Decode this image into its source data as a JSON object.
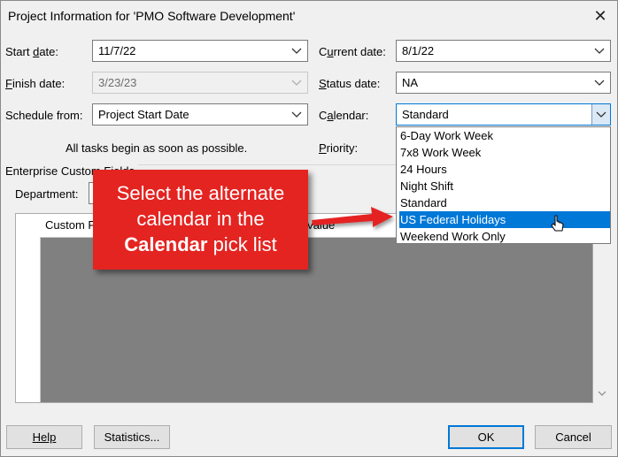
{
  "window": {
    "title": "Project Information for 'PMO Software Development'",
    "close_glyph": "✕"
  },
  "fields": {
    "start_date": {
      "label_pre": "Start ",
      "label_u": "d",
      "label_post": "ate:",
      "value": "11/7/22"
    },
    "finish_date": {
      "label_pre": "",
      "label_u": "F",
      "label_post": "inish date:",
      "value": "3/23/23"
    },
    "schedule_from": {
      "label": "Schedule from:",
      "value": "Project Start Date"
    },
    "schedule_note": "All tasks begin as soon as possible.",
    "current_date": {
      "label_pre": "C",
      "label_u": "u",
      "label_post": "rrent date:",
      "value": "8/1/22"
    },
    "status_date": {
      "label_pre": "",
      "label_u": "S",
      "label_post": "tatus date:",
      "value": "NA"
    },
    "calendar": {
      "label_pre": "C",
      "label_u": "a",
      "label_post": "lendar:",
      "value": "Standard"
    },
    "priority": {
      "label_pre": "",
      "label_u": "P",
      "label_post": "riority:"
    }
  },
  "calendar_options": [
    {
      "label": "6-Day Work Week",
      "selected": false
    },
    {
      "label": "7x8 Work Week",
      "selected": false
    },
    {
      "label": "24 Hours",
      "selected": false
    },
    {
      "label": "Night Shift",
      "selected": false
    },
    {
      "label": "Standard",
      "selected": false
    },
    {
      "label": "US Federal Holidays",
      "selected": true
    },
    {
      "label": "Weekend Work Only",
      "selected": false
    }
  ],
  "enterprise": {
    "section_label": "Enterprise Custom Fields",
    "department_label": "Department:",
    "grid_headers": [
      "Custom F",
      "Value"
    ]
  },
  "buttons": {
    "help": "Help",
    "statistics": "Statistics...",
    "ok": "OK",
    "cancel": "Cancel"
  },
  "callout": {
    "line1": "Select the alternate",
    "line2": "calendar in the",
    "line3_bold": "Calendar",
    "line3_rest": " pick list"
  },
  "colors": {
    "accent": "#0078d7",
    "callout": "#e42421",
    "arrow": "#e42421"
  }
}
